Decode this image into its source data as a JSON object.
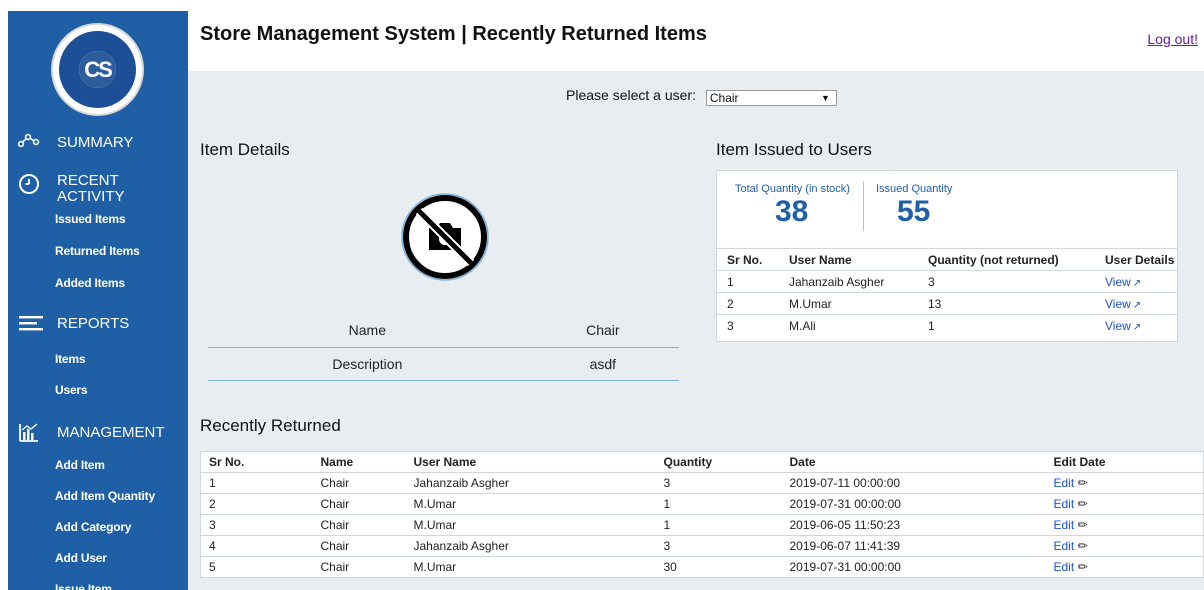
{
  "header": {
    "title": "Store Management System | Recently Returned Items",
    "logout": "Log out!"
  },
  "sidebar": {
    "logo_text": "CS",
    "sections": [
      {
        "icon": "summary-icon",
        "title": "SUMMARY",
        "items": []
      },
      {
        "icon": "clock-icon",
        "title_line1": "RECENT",
        "title_line2": "ACTIVITY",
        "items": [
          "Issued Items",
          "Returned Items",
          "Added Items"
        ]
      },
      {
        "icon": "reports-icon",
        "title": "REPORTS",
        "items": [
          "Items",
          "Users"
        ]
      },
      {
        "icon": "chart-icon",
        "title": "MANAGEMENT",
        "items": [
          "Add Item",
          "Add Item Quantity",
          "Add Category",
          "Add User",
          "Issue Item"
        ]
      }
    ]
  },
  "user_select": {
    "label": "Please select a user:",
    "value": "Chair"
  },
  "item_details": {
    "title": "Item Details",
    "image_icon": "no-photo-icon",
    "rows": [
      {
        "label": "Name",
        "value": "Chair"
      },
      {
        "label": "Description",
        "value": "asdf"
      }
    ]
  },
  "issued": {
    "title": "Item Issued to Users",
    "total_label": "Total Quantity (in stock)",
    "total_value": "38",
    "issued_label": "Issued Quantity",
    "issued_value": "55",
    "headers": [
      "Sr No.",
      "User Name",
      "Quantity (not returned)",
      "User Details"
    ],
    "rows": [
      {
        "sr": "1",
        "user": "Jahanzaib Asgher",
        "qty": "3",
        "link": "View"
      },
      {
        "sr": "2",
        "user": "M.Umar",
        "qty": "13",
        "link": "View"
      },
      {
        "sr": "3",
        "user": "M.Ali",
        "qty": "1",
        "link": "View"
      }
    ]
  },
  "returned": {
    "title": "Recently Returned",
    "headers": [
      "Sr No.",
      "Name",
      "User Name",
      "Quantity",
      "Date",
      "Edit Date"
    ],
    "edit_label": "Edit",
    "rows": [
      {
        "sr": "1",
        "name": "Chair",
        "user": "Jahanzaib Asgher",
        "qty": "3",
        "date": "2019-07-11 00:00:00"
      },
      {
        "sr": "2",
        "name": "Chair",
        "user": "M.Umar",
        "qty": "1",
        "date": "2019-07-31 00:00:00"
      },
      {
        "sr": "3",
        "name": "Chair",
        "user": "M.Umar",
        "qty": "1",
        "date": "2019-06-05 11:50:23"
      },
      {
        "sr": "4",
        "name": "Chair",
        "user": "Jahanzaib Asgher",
        "qty": "3",
        "date": "2019-06-07 11:41:39"
      },
      {
        "sr": "5",
        "name": "Chair",
        "user": "M.Umar",
        "qty": "30",
        "date": "2019-07-31 00:00:00"
      }
    ]
  },
  "colors": {
    "sidebar": "#1f5fa6",
    "background": "#e8edf1",
    "accent": "#1f5fa6",
    "link": "#1a4fd6"
  }
}
